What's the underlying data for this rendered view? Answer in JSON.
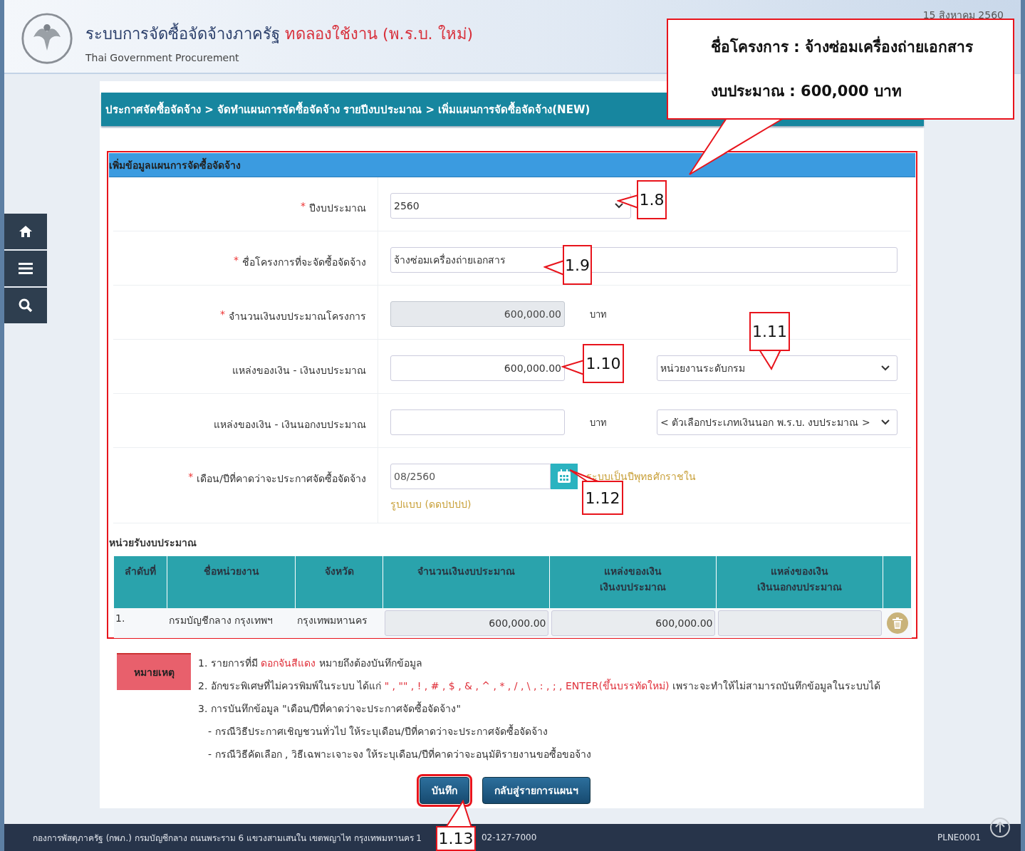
{
  "header": {
    "title": "ระบบการจัดซื้อจัดจ้างภาครัฐ",
    "title_tag": "ทดลองใช้งาน (พ.ร.บ. ใหม่)",
    "subtitle": "Thai Government Procurement",
    "date": "15 สิงหาคม 2560"
  },
  "breadcrumb": "ประกาศจัดซื้อจัดจ้าง > จัดทำแผนการจัดซื้อจัดจ้าง รายปีงบประมาณ > เพิ่มแผนการจัดซื้อจัดจ้าง(NEW)",
  "form": {
    "title": "เพิ่มข้อมูลแผนการจัดซื้อจัดจ้าง",
    "fields": [
      {
        "kind": "select",
        "mark": "*",
        "label": "ปีงบประมาณ",
        "value": "2560"
      },
      {
        "kind": "text",
        "mark": "*",
        "label": "ชื่อโครงการที่จะจัดซื้อจัดจ้าง",
        "value": "จ้างซ่อมเครื่องถ่ายเอกสาร"
      },
      {
        "kind": "amount",
        "mark": "*",
        "label": "จำนวนเงินงบประมาณโครงการ",
        "readonly": true,
        "value": "600,000.00",
        "unit": "บาท"
      },
      {
        "kind": "amount",
        "label": "แหล่งของเงิน - เงินงบประมาณ",
        "readonly": false,
        "value": "600,000.00",
        "select": "หน่วยงานระดับกรม"
      },
      {
        "kind": "amount",
        "label": "แหล่งของเงิน - เงินนอกงบประมาณ",
        "readonly": false,
        "unit": "บาท",
        "select": "< ตัวเลือกประเภทเงินนอก พ.ร.บ. งบประมาณ >"
      },
      {
        "kind": "date",
        "mark": "*",
        "label": "เดือน/ปีที่คาดว่าจะประกาศจัดซื้อจัดจ้าง",
        "value": "08/2560",
        "hint": "ระบบเป็นปีพุทธศักราชใน",
        "format": "รูปแบบ (ดดปปปป)"
      }
    ]
  },
  "budget_units": {
    "title": "หน่วยรับงบประมาณ",
    "columns": [
      "ลำดับที่",
      "ชื่อหน่วยงาน",
      "จังหวัด",
      "จำนวนเงินงบประมาณ",
      "แหล่งของเงิน\nเงินงบประมาณ",
      "แหล่งของเงิน\nเงินนอกงบประมาณ"
    ],
    "rows": [
      {
        "index": "1.",
        "unit": "กรมบัญชีกลาง กรุงเทพฯ",
        "province": "กรุงเทพมหานคร",
        "amount": "600,000.00",
        "budget": "600,000.00"
      }
    ]
  },
  "notes": {
    "tag": "หมายเหตุ",
    "items": [
      {
        "kind": "item",
        "parts": [
          {
            "text": "1. รายการที่มี ",
            "red": false
          },
          {
            "text": "ดอกจันสีแดง",
            "red": true
          },
          {
            "text": " หมายถึงต้องบันทึกข้อมูล",
            "red": false
          }
        ]
      },
      {
        "kind": "item",
        "parts": [
          {
            "text": "2. อักขระพิเศษที่ไม่ควรพิมพ์ในระบบ ได้แก่ ",
            "red": false
          },
          {
            "text": "\" , \"\" , ! , # , $ , & , ^ , * , / , \\ , : , ; , ENTER(ขึ้นบรรทัดใหม่)",
            "red": true
          },
          {
            "text": " เพราะจะทำให้ไม่สามารถบันทึกข้อมูลในระบบได้",
            "red": false
          }
        ]
      },
      {
        "kind": "item",
        "parts": [
          {
            "text": "3. การบันทึกข้อมูล \"เดือน/ปีที่คาดว่าจะประกาศจัดซื้อจัดจ้าง\"",
            "red": false
          }
        ]
      },
      {
        "kind": "sub",
        "parts": [
          {
            "text": "- กรณีวิธีประกาศเชิญชวนทั่วไป ให้ระบุเดือน/ปีที่คาดว่าจะประกาศจัดซื้อจัดจ้าง",
            "red": false
          }
        ]
      },
      {
        "kind": "sub",
        "parts": [
          {
            "text": "- กรณีวิธีคัดเลือก , วิธีเฉพาะเจาะจง ให้ระบุเดือน/ปีที่คาดว่าจะอนุมัติรายงานขอซื้อขอจ้าง",
            "red": false
          }
        ]
      }
    ]
  },
  "buttons": [
    {
      "label": "บันทึก",
      "highlighted": true
    },
    {
      "label": "กลับสู่รายการแผนฯ",
      "highlighted": false
    }
  ],
  "footer": {
    "address": "กองการพัสดุภาครัฐ (กพภ.) กรมบัญชีกลาง ถนนพระราม 6 แขวงสามเสนใน เขตพญาไท กรุงเทพมหานคร 1",
    "phone": "02-127-7000",
    "code": "PLNE0001"
  },
  "callouts": [
    {
      "kind": "info",
      "lines": [
        "ชื่อโครงการ : จ้างซ่อมเครื่องถ่ายเอกสาร",
        "งบประมาณ : 600,000 บาท"
      ]
    },
    {
      "kind": "step",
      "label": "1.8"
    },
    {
      "kind": "step",
      "label": "1.9"
    },
    {
      "kind": "step",
      "label": "1.10"
    },
    {
      "kind": "step",
      "label": "1.11"
    },
    {
      "kind": "step",
      "label": "1.12"
    },
    {
      "kind": "step",
      "label": "1.13"
    }
  ]
}
